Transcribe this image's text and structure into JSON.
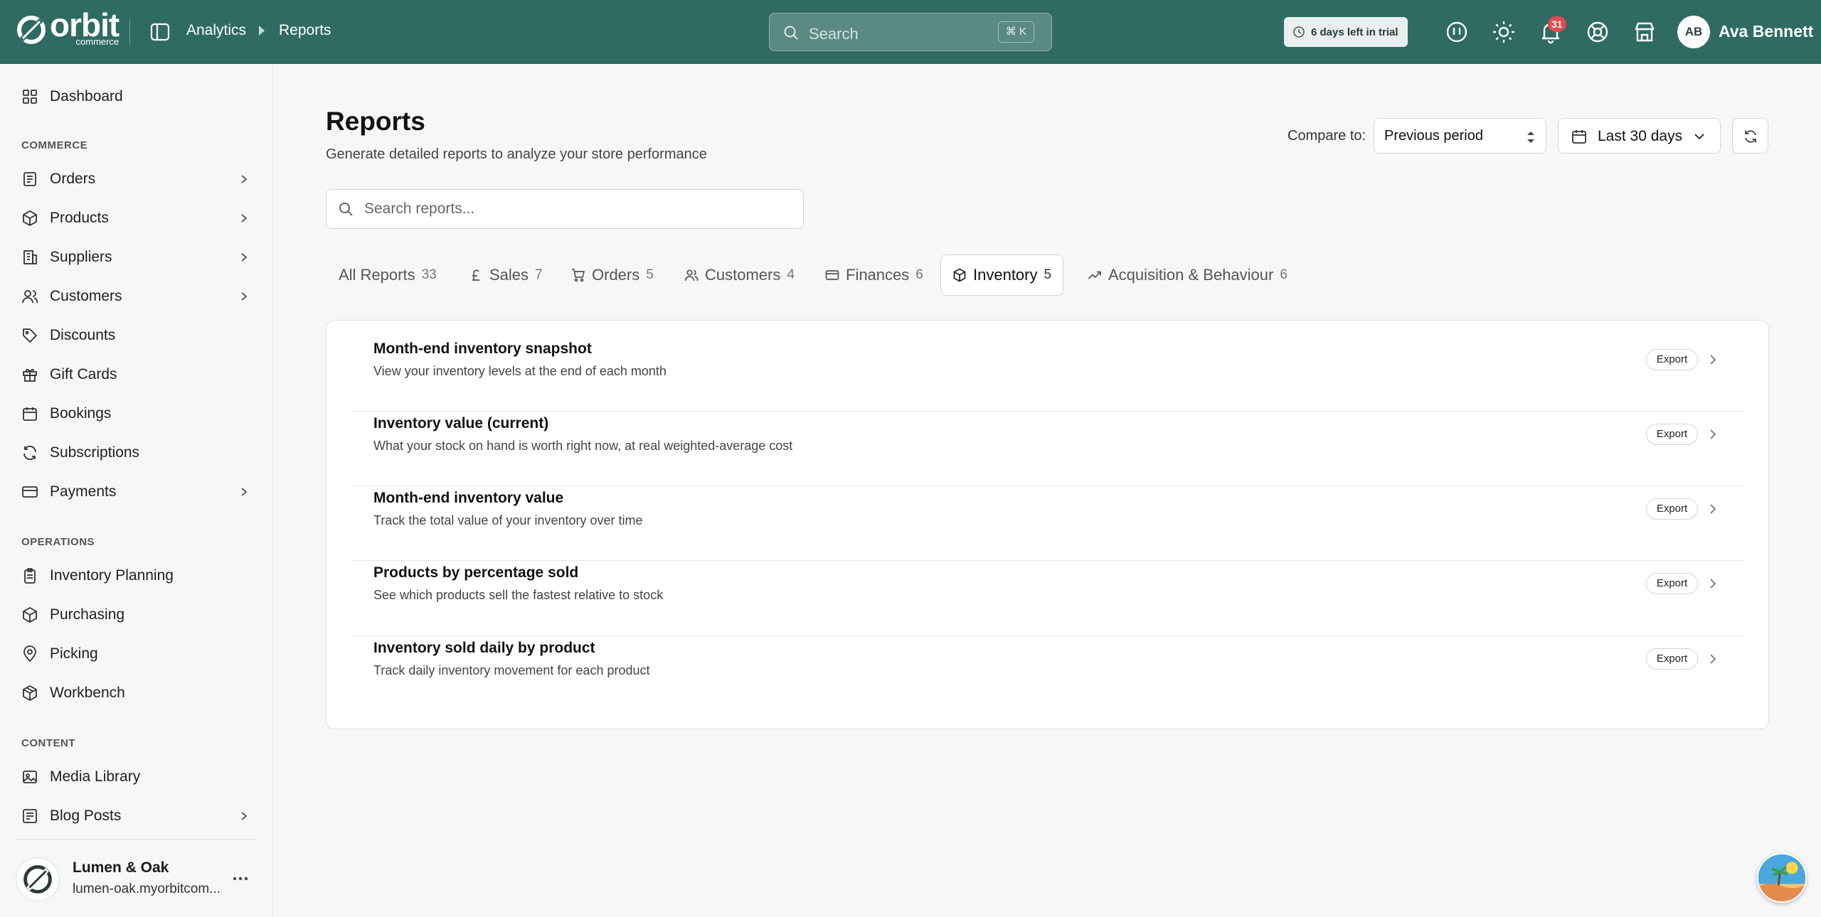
{
  "brand": {
    "name": "orbit",
    "sub": "commerce"
  },
  "breadcrumb": {
    "section": "Analytics",
    "page": "Reports"
  },
  "search": {
    "placeholder": "Search",
    "shortcut": "⌘ K"
  },
  "trial": {
    "text": "6 days left in trial"
  },
  "notifications": {
    "count": "31"
  },
  "user": {
    "initials": "AB",
    "name": "Ava Bennett"
  },
  "sidebar": {
    "items_top": [
      {
        "label": "Dashboard",
        "icon": "dashboard-icon"
      }
    ],
    "sections": [
      {
        "label": "COMMERCE",
        "items": [
          {
            "label": "Orders",
            "icon": "orders-icon",
            "has_children": true
          },
          {
            "label": "Products",
            "icon": "box-icon",
            "has_children": true
          },
          {
            "label": "Suppliers",
            "icon": "building-icon",
            "has_children": true
          },
          {
            "label": "Customers",
            "icon": "users-icon",
            "has_children": true
          },
          {
            "label": "Discounts",
            "icon": "tag-icon",
            "has_children": false
          },
          {
            "label": "Gift Cards",
            "icon": "gift-icon",
            "has_children": false
          },
          {
            "label": "Bookings",
            "icon": "calendar-icon",
            "has_children": false
          },
          {
            "label": "Subscriptions",
            "icon": "repeat-icon",
            "has_children": false
          },
          {
            "label": "Payments",
            "icon": "credit-card-icon",
            "has_children": true
          }
        ]
      },
      {
        "label": "OPERATIONS",
        "items": [
          {
            "label": "Inventory Planning",
            "icon": "clipboard-icon",
            "has_children": false
          },
          {
            "label": "Purchasing",
            "icon": "cube-icon",
            "has_children": false
          },
          {
            "label": "Picking",
            "icon": "map-pin-icon",
            "has_children": false
          },
          {
            "label": "Workbench",
            "icon": "cubes-icon",
            "has_children": false
          }
        ]
      },
      {
        "label": "CONTENT",
        "items": [
          {
            "label": "Media Library",
            "icon": "image-icon",
            "has_children": false
          },
          {
            "label": "Blog Posts",
            "icon": "blog-icon",
            "has_children": true
          }
        ]
      }
    ]
  },
  "store": {
    "name": "Lumen & Oak",
    "url": "lumen-oak.myorbitcom..."
  },
  "page": {
    "title": "Reports",
    "subtitle": "Generate detailed reports to analyze your store performance",
    "compare_label": "Compare to:",
    "compare_value": "Previous period",
    "date_range": "Last 30 days",
    "report_search_placeholder": "Search reports..."
  },
  "tabs": [
    {
      "label": "All Reports",
      "count": "33",
      "icon": ""
    },
    {
      "label": "Sales",
      "count": "7",
      "icon": "pound-icon"
    },
    {
      "label": "Orders",
      "count": "5",
      "icon": "cart-icon"
    },
    {
      "label": "Customers",
      "count": "4",
      "icon": "users-icon"
    },
    {
      "label": "Finances",
      "count": "6",
      "icon": "credit-card-icon"
    },
    {
      "label": "Inventory",
      "count": "5",
      "icon": "cube-icon",
      "active": true
    },
    {
      "label": "Acquisition & Behaviour",
      "count": "6",
      "icon": "trending-up-icon"
    }
  ],
  "reports": [
    {
      "title": "Month-end inventory snapshot",
      "desc": "View your inventory levels at the end of each month",
      "action": "Export"
    },
    {
      "title": "Inventory value (current)",
      "desc": "What your stock on hand is worth right now, at real weighted-average cost",
      "action": "Export"
    },
    {
      "title": "Month-end inventory value",
      "desc": "Track the total value of your inventory over time",
      "action": "Export"
    },
    {
      "title": "Products by percentage sold",
      "desc": "See which products sell the fastest relative to stock",
      "action": "Export"
    },
    {
      "title": "Inventory sold daily by product",
      "desc": "Track daily inventory movement for each product",
      "action": "Export"
    }
  ],
  "colors": {
    "topbar": "#2f6b62",
    "badge": "#e5484d",
    "background": "#f7f7f7"
  }
}
